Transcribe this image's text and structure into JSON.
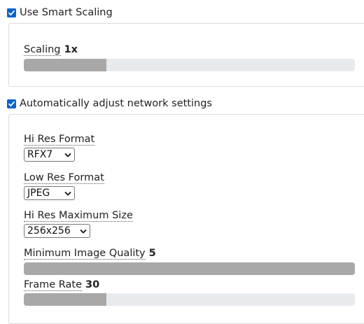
{
  "smart_scaling": {
    "label": "Use Smart Scaling",
    "checked": true,
    "scaling": {
      "label": "Scaling",
      "value": "1x",
      "fraction": 0.25
    }
  },
  "network": {
    "label": "Automatically adjust network settings",
    "checked": true,
    "hi_res_format": {
      "label": "Hi Res Format",
      "selected": "RFX7"
    },
    "low_res_format": {
      "label": "Low Res Format",
      "selected": "JPEG"
    },
    "hi_res_max_size": {
      "label": "Hi Res Maximum Size",
      "selected": "256x256"
    },
    "min_image_quality": {
      "label": "Minimum Image Quality",
      "value": "5",
      "fraction": 1.0
    },
    "frame_rate": {
      "label": "Frame Rate",
      "value": "30",
      "fraction": 0.25
    }
  },
  "colors": {
    "accent": "#0b63c9",
    "slider_track": "#e8ebee",
    "slider_fill": "#a8a8a8"
  }
}
